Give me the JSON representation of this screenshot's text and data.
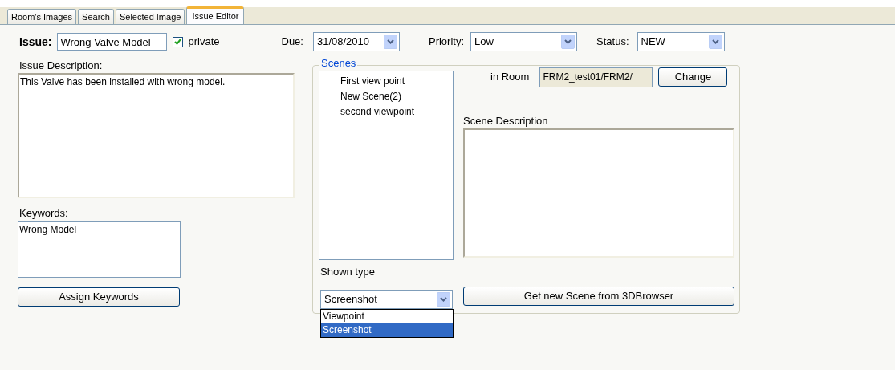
{
  "tabs": [
    {
      "label": "Room's Images",
      "selected": false
    },
    {
      "label": "Search",
      "selected": false
    },
    {
      "label": "Selected Image",
      "selected": false
    },
    {
      "label": "Issue Editor",
      "selected": true
    }
  ],
  "issue": {
    "label": "Issue:",
    "value": "Wrong Valve Model",
    "private": {
      "label": "private",
      "checked": true
    }
  },
  "due": {
    "label": "Due:",
    "value": "31/08/2010"
  },
  "priority": {
    "label": "Priority:",
    "value": "Low"
  },
  "status": {
    "label": "Status:",
    "value": "NEW"
  },
  "description": {
    "label": "Issue Description:",
    "value": "This Valve has been installed with wrong model."
  },
  "keywords": {
    "label": "Keywords:",
    "items": [
      "Wrong Model"
    ],
    "button": "Assign Keywords"
  },
  "scenes": {
    "title": "Scenes",
    "items": [
      "First view point",
      "New Scene(2)",
      "second viewpoint"
    ],
    "in_room": {
      "label": "in Room",
      "value": "FRM2_test01/FRM2/"
    },
    "change_button": "Change",
    "scene_description": {
      "label": "Scene Description"
    },
    "shown_type": {
      "label": "Shown type",
      "value": "Screenshot",
      "expanded": true,
      "options": [
        {
          "label": "Viewpoint",
          "selected": false
        },
        {
          "label": "Screenshot",
          "selected": true
        }
      ]
    },
    "get_scene_button": "Get new Scene from 3DBrowser"
  }
}
